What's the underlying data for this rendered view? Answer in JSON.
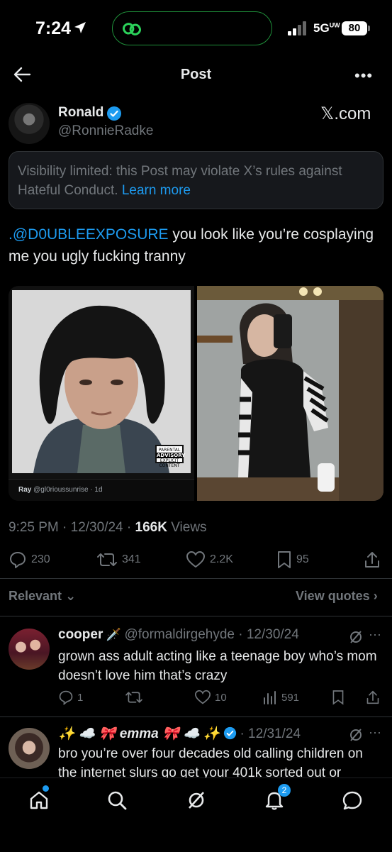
{
  "status_bar": {
    "time": "7:24",
    "network": "5G",
    "network_sup": "UW",
    "battery": "80"
  },
  "header": {
    "title": "Post",
    "more": "•••"
  },
  "post": {
    "author_name": "Ronald",
    "author_handle": "@RonnieRadke",
    "source_logo": "𝕏.com",
    "visibility_notice": "Visibility limited: this Post may violate X’s rules against Hateful Conduct.",
    "learn_more": "Learn more",
    "mention": ".@D0UBLEEXPOSURE",
    "text": " you look like you’re cosplaying me you ugly fucking tranny",
    "embedded_caption_name": "Ray",
    "embedded_caption_handle": "@gl0rioussunrise · 1d",
    "parental_advisory": "PARENTAL ADVISORY EXPLICIT CONTENT",
    "timestamp": "9:25 PM · 12/30/24 · ",
    "views_count": "166K",
    "views_label": " Views",
    "replies": "230",
    "reposts": "341",
    "likes": "2.2K",
    "bookmarks": "95"
  },
  "sort": {
    "label": "Relevant",
    "view_quotes": "View quotes"
  },
  "replies": [
    {
      "name": "cooper",
      "name_emoji": "🗡️",
      "handle_date": "@formaldirgehyde · 12/30/24",
      "text": "grown ass adult acting like a teenage boy who’s mom doesn’t love him that’s crazy",
      "replies": "1",
      "reposts": "",
      "likes": "10",
      "views": "591"
    },
    {
      "name": "✨ ☁️ 🎀 emma 🎀 ☁️ ✨",
      "handle_date": "· 12/31/24",
      "text": "bro you’re over four decades old calling children on the internet slurs go get your 401k sorted out or"
    }
  ],
  "bottom_nav": {
    "notifications_count": "2"
  },
  "colors": {
    "accent": "#1d9bf0",
    "background": "#000000",
    "muted": "#71767b"
  }
}
